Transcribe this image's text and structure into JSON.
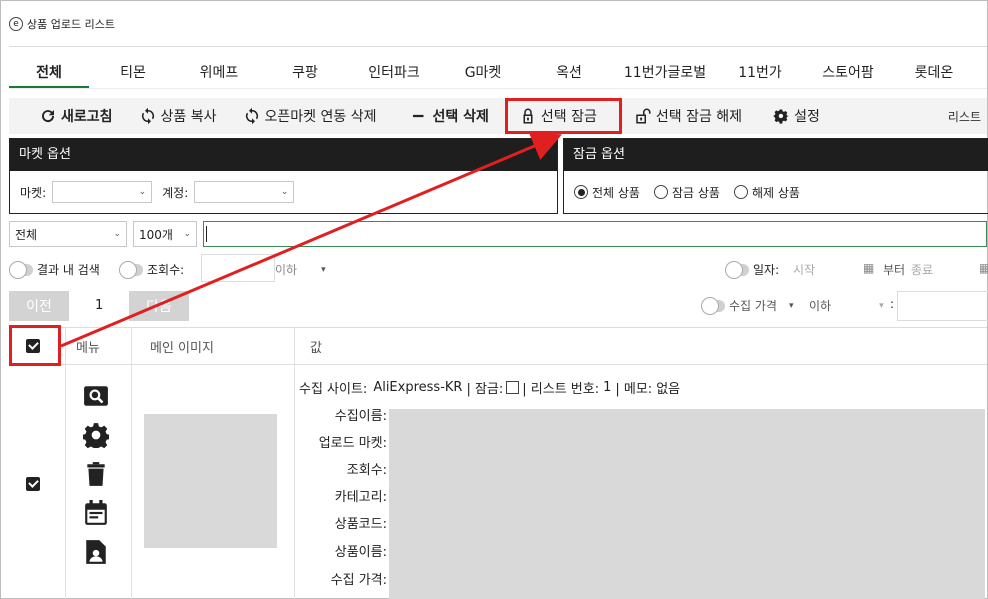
{
  "window": {
    "title": "상품 업로드 리스트"
  },
  "tabs": [
    {
      "label": "전체",
      "active": true
    },
    {
      "label": "티몬"
    },
    {
      "label": "위메프"
    },
    {
      "label": "쿠팡"
    },
    {
      "label": "인터파크"
    },
    {
      "label": "G마켓"
    },
    {
      "label": "옥션"
    },
    {
      "label": "11번가글로벌"
    },
    {
      "label": "11번가"
    },
    {
      "label": "스토어팜"
    },
    {
      "label": "롯데온"
    }
  ],
  "toolbar": {
    "refresh": "새로고침",
    "copy": "상품 복사",
    "unlink": "오픈마켓 연동 삭제",
    "delete": "선택 삭제",
    "lock": "선택 잠금",
    "unlock": "선택 잠금 해제",
    "settings": "설정",
    "right_label": "리스트"
  },
  "market_panel": {
    "title": "마켓 옵션",
    "market_label": "마켓:",
    "market_value": "",
    "account_label": "계정:",
    "account_value": ""
  },
  "lock_panel": {
    "title": "잠금 옵션",
    "options": [
      "전체 상품",
      "잠금 상품",
      "해제 상품"
    ],
    "selected": "전체 상품"
  },
  "filter": {
    "category": "전체",
    "count": "100개",
    "search_value": ""
  },
  "row3": {
    "in_results": "결과 내 검색",
    "views": "조회수:",
    "views_value": "",
    "below": "이하",
    "date": "일자:",
    "start": "시작",
    "from": "부터",
    "end": "종료"
  },
  "row4": {
    "prev": "이전",
    "page": "1",
    "next": "다음",
    "price": "수집 가격",
    "below": "이하",
    "colon": ":"
  },
  "table": {
    "headers": {
      "menu": "메뉴",
      "image": "메인 이미지",
      "value": "값"
    },
    "row": {
      "site_label": "수집 사이트:",
      "site_value": "AliExpress-KR",
      "lock_label": "| 잠금:",
      "list_label": "| 리스트 번호:",
      "list_no": "1",
      "memo_label": "| 메모:",
      "memo_value": "없음",
      "fields": [
        "수집이름:",
        "업로드 마켓:",
        "조회수:",
        "카테고리:",
        "상품코드:",
        "상품이름:",
        "수집 가격:"
      ]
    }
  },
  "menu_icons": [
    "search-icon",
    "gear-icon",
    "trash-icon",
    "calendar-icon",
    "contact-file-icon"
  ],
  "colors": {
    "accent": "#1a7a33",
    "highlight": "#e02020",
    "header_bg": "#1e1e1e"
  }
}
